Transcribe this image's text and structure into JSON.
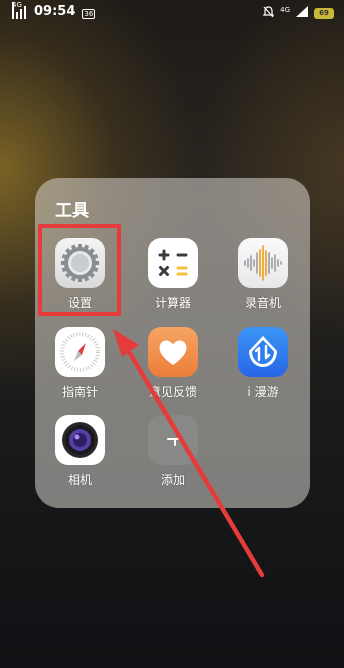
{
  "status_bar": {
    "network_left": "4G",
    "time": "09:54",
    "notification_badge": "36",
    "network_right": "4G",
    "battery": "69"
  },
  "folder": {
    "title": "工具",
    "apps": [
      {
        "label": "设置",
        "icon": "settings-gear-icon"
      },
      {
        "label": "计算器",
        "icon": "calculator-icon"
      },
      {
        "label": "录音机",
        "icon": "sound-recorder-icon"
      },
      {
        "label": "指南针",
        "icon": "compass-icon"
      },
      {
        "label": "意见反馈",
        "icon": "heart-feedback-icon"
      },
      {
        "label": "i 漫游",
        "icon": "roaming-icon"
      },
      {
        "label": "相机",
        "icon": "camera-icon"
      },
      {
        "label": "添加",
        "icon": "add-icon"
      }
    ]
  },
  "annotation": {
    "color": "#e53b3b"
  }
}
